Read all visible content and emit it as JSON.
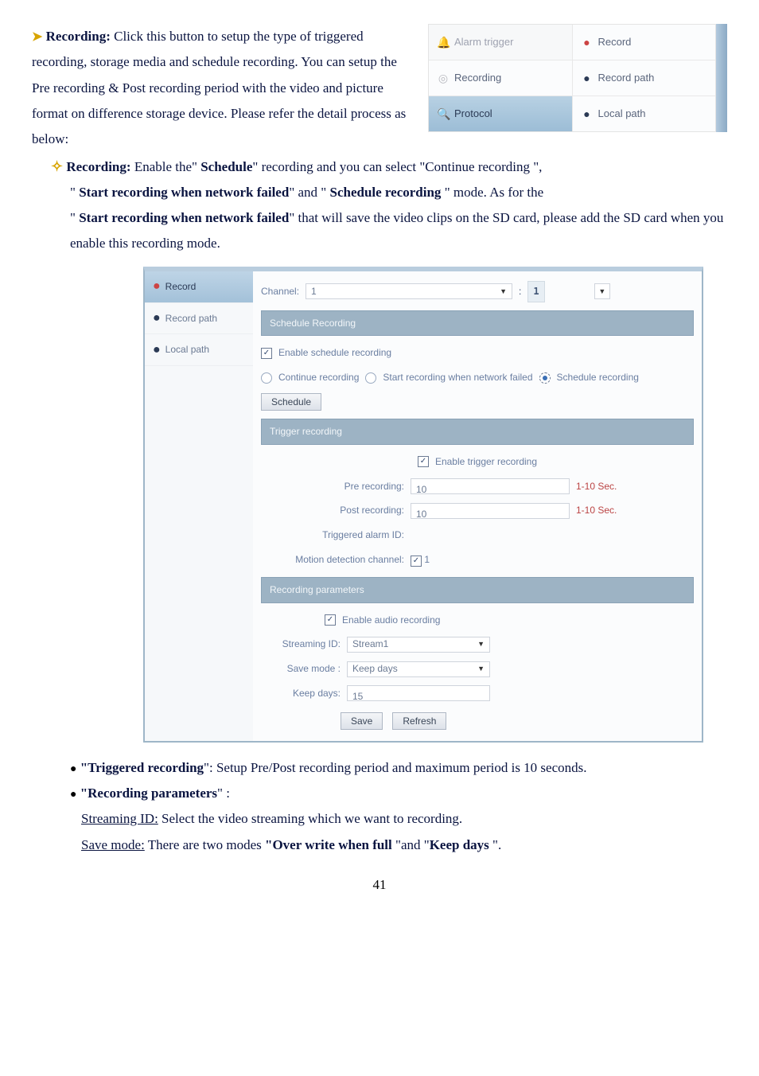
{
  "doc": {
    "recording_heading": "Recording:",
    "recording_desc1": " Click this button to setup the type of triggered recording, storage media and schedule recording. You can setup the Pre recording & Post recording period with the video and picture format on difference storage device.    Please refer the detail process as below:",
    "recording_sub_heading": "Recording:",
    "recording_sub_text1": " Enable the\" ",
    "schedule_bold": "Schedule",
    "recording_sub_text2": "\" recording and you can select \"Continue recording \",",
    "line2a": "\" ",
    "line2b": "Start recording when network failed",
    "line2c": "\" and \" ",
    "line2d": "Schedule recording",
    "line2e": " \" mode.      As for the ",
    "line3a": "\" ",
    "line3b": "Start recording when network failed",
    "line3c": "\" that will save the video clips on the SD card, please add the SD card when you enable this recording mode.",
    "triggered_heading": "\"Triggered recording",
    "triggered_text": "\": Setup Pre/Post recording period and maximum period is 10 seconds.",
    "params_heading": "\"Recording parameters",
    "stream_u": "Streaming ID:",
    "stream_text": " Select the video streaming which we want to recording.",
    "savemode_u": "Save mode:",
    "savemode_text1": " There are two modes ",
    "over_write": "\"Over write when full ",
    "savemode_text2": "\"and \"",
    "keep_days_bold": "Keep days ",
    "savemode_text3": "\".",
    "pagenum": "41"
  },
  "tabs": {
    "alarm": "Alarm trigger",
    "recording": "Recording",
    "protocol": "Protocol",
    "record": "Record",
    "record_path": "Record path",
    "local_path": "Local path"
  },
  "side": {
    "record": "Record",
    "record_path": "Record path",
    "local_path": "Local path"
  },
  "app": {
    "channel_lbl": "Channel:",
    "channel_val": "1",
    "colon_one": "1",
    "schedule_head": "Schedule Recording",
    "enable_schedule": "Enable schedule recording",
    "continue": "Continue recording",
    "start_net_fail": "Start recording when network failed",
    "schedule_recording": "Schedule recording",
    "schedule_btn": "Schedule",
    "trigger_head": "Trigger recording",
    "enable_trigger": "Enable trigger recording",
    "pre_lbl": "Pre recording:",
    "pre_val": "10",
    "post_lbl": "Post recording:",
    "post_val": "10",
    "range": "1-10 Sec.",
    "trig_id_lbl": "Triggered alarm ID:",
    "motion_lbl": "Motion detection channel:",
    "motion_val": "1",
    "rec_params_head": "Recording parameters",
    "enable_audio": "Enable audio recording",
    "stream_id_lbl": "Streaming ID:",
    "stream_id_val": "Stream1",
    "save_mode_lbl": "Save mode :",
    "save_mode_val": "Keep days",
    "keep_days_lbl": "Keep days:",
    "keep_days_val": "15",
    "save_btn": "Save",
    "refresh_btn": "Refresh"
  }
}
